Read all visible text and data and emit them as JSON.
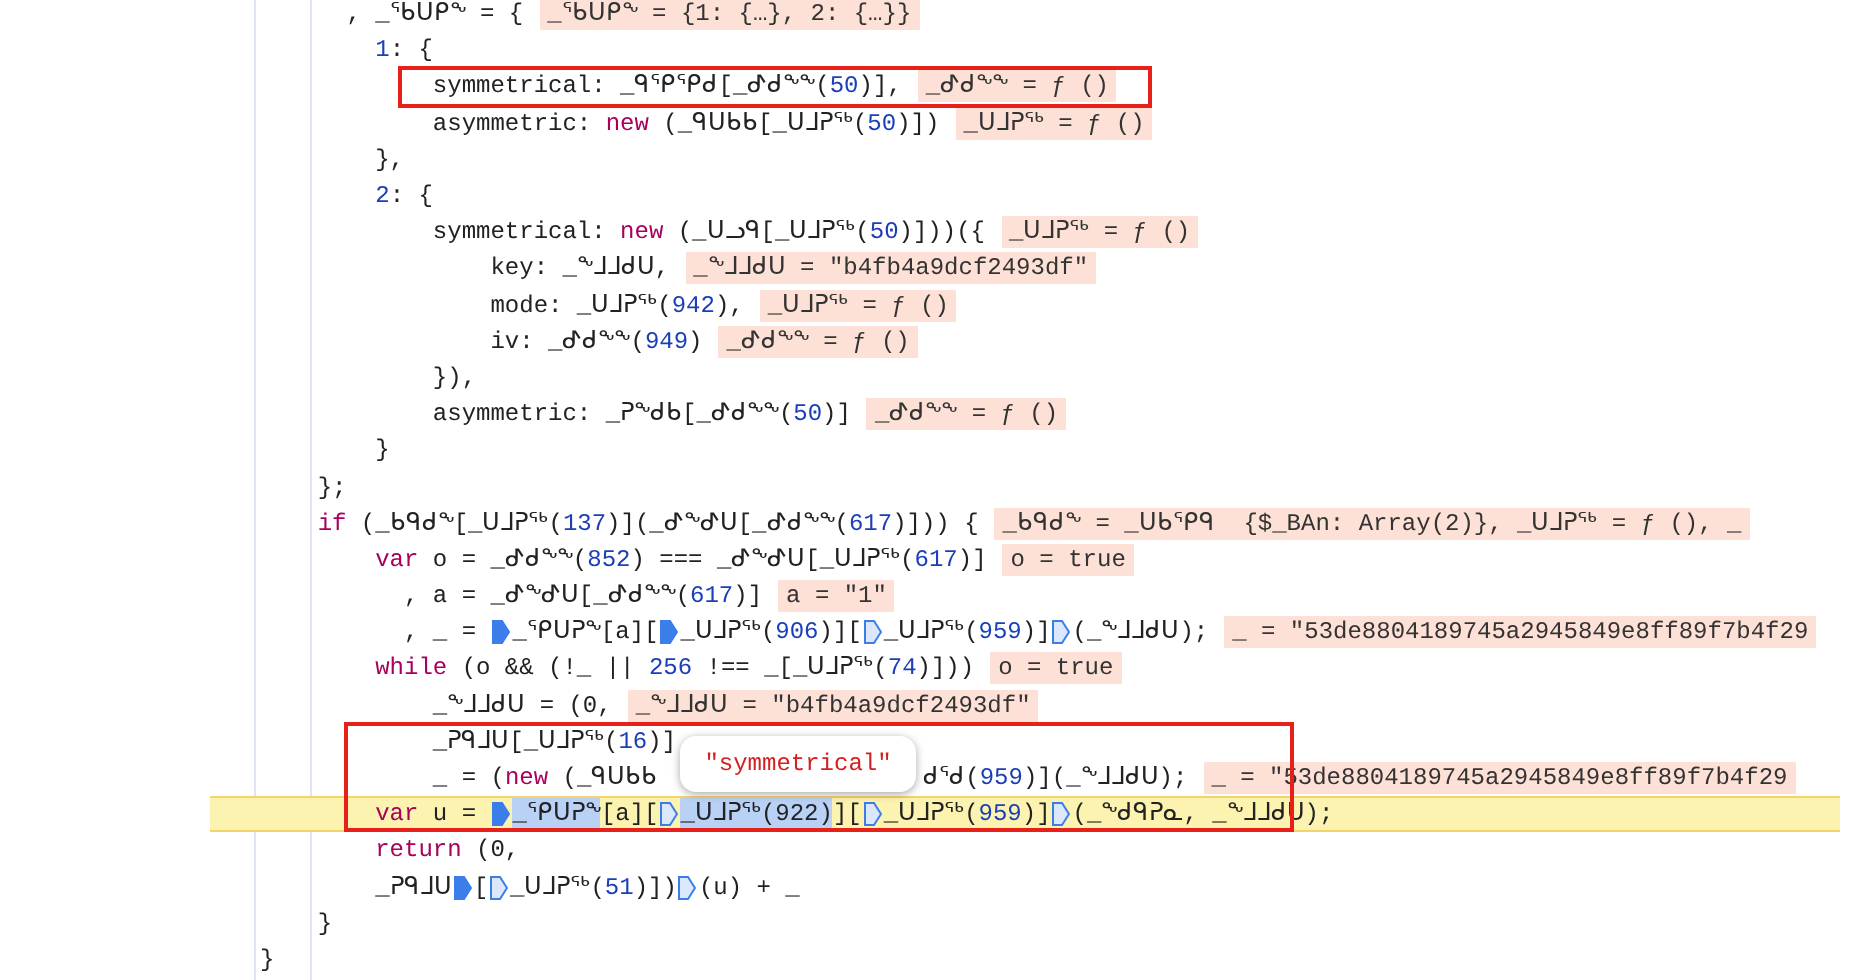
{
  "code_lines": [
    {
      "tokens": [
        {
          "t": "      , _ᖃᑌᑭᖕ = {",
          "kind": "code"
        }
      ],
      "value": "_ᖃᑌᑭᖕ = {1: {…}, 2: {…}}",
      "current": false
    },
    {
      "tokens": [
        {
          "t": "        1",
          "kind": "num"
        },
        {
          "t": ": {",
          "kind": "code"
        }
      ],
      "current": false
    },
    {
      "tokens": [
        {
          "t": "            symmetrical: _ᑫᕿᕿᑯ[_ᕷᑯᖕᖕ(",
          "kind": "code"
        },
        {
          "t": "50",
          "kind": "num"
        },
        {
          "t": ")],",
          "kind": "code"
        }
      ],
      "value": "_ᕷᑯᖕᖕ = ƒ ()",
      "current": false
    },
    {
      "tokens": [
        {
          "t": "            asymmetric: ",
          "kind": "code"
        },
        {
          "t": "new",
          "kind": "kw"
        },
        {
          "t": " (_ᑫᑌᑲᑲ[_ᑌᒧᕈᖅ(",
          "kind": "code"
        },
        {
          "t": "50",
          "kind": "num"
        },
        {
          "t": ")])",
          "kind": "code"
        }
      ],
      "value": "_ᑌᒧᕈᖅ = ƒ ()",
      "current": false
    },
    {
      "tokens": [
        {
          "t": "        },",
          "kind": "code"
        }
      ],
      "current": false
    },
    {
      "tokens": [
        {
          "t": "        2",
          "kind": "num"
        },
        {
          "t": ": {",
          "kind": "code"
        }
      ],
      "current": false
    },
    {
      "tokens": [
        {
          "t": "            symmetrical: ",
          "kind": "code"
        },
        {
          "t": "new",
          "kind": "kw"
        },
        {
          "t": " (_ᑌᓗᑫ[_ᑌᒧᕈᖅ(",
          "kind": "code"
        },
        {
          "t": "50",
          "kind": "num"
        },
        {
          "t": ")]))({",
          "kind": "code"
        }
      ],
      "value": "_ᑌᒧᕈᖅ = ƒ ()",
      "current": false
    },
    {
      "tokens": [
        {
          "t": "                key: _ᖕᒧᒧᑯᑌ,",
          "kind": "code"
        }
      ],
      "value": "_ᖕᒧᒧᑯᑌ = \"b4fb4a9dcf2493df\"",
      "current": false
    },
    {
      "tokens": [
        {
          "t": "                mode: _ᑌᒧᕈᖅ(",
          "kind": "code"
        },
        {
          "t": "942",
          "kind": "num"
        },
        {
          "t": "),",
          "kind": "code"
        }
      ],
      "value": "_ᑌᒧᕈᖅ = ƒ ()",
      "current": false
    },
    {
      "tokens": [
        {
          "t": "                iv: _ᕷᑯᖕᖕ(",
          "kind": "code"
        },
        {
          "t": "949",
          "kind": "num"
        },
        {
          "t": ")",
          "kind": "code"
        }
      ],
      "value": "_ᕷᑯᖕᖕ = ƒ ()",
      "current": false
    },
    {
      "tokens": [
        {
          "t": "            }),",
          "kind": "code"
        }
      ],
      "current": false
    },
    {
      "tokens": [
        {
          "t": "            asymmetric: _ᕈᖕᑯᑲ[_ᕷᑯᖕᖕ(",
          "kind": "code"
        },
        {
          "t": "50",
          "kind": "num"
        },
        {
          "t": ")]",
          "kind": "code"
        }
      ],
      "value": "_ᕷᑯᖕᖕ = ƒ ()",
      "current": false
    },
    {
      "tokens": [
        {
          "t": "        }",
          "kind": "code"
        }
      ],
      "current": false
    },
    {
      "tokens": [
        {
          "t": "    };",
          "kind": "code"
        }
      ],
      "current": false
    },
    {
      "tokens": [
        {
          "t": "    if",
          "kind": "kw"
        },
        {
          "t": " (_ᑲᑫᑯᖕ[_ᑌᒧᕈᖅ(",
          "kind": "code"
        },
        {
          "t": "137",
          "kind": "num"
        },
        {
          "t": ")](_ᕷᖕᕷᑌ[_ᕷᑯᖕᖕ(",
          "kind": "code"
        },
        {
          "t": "617",
          "kind": "num"
        },
        {
          "t": ")])) {",
          "kind": "code"
        }
      ],
      "value": "_ᑲᑫᑯᖕ = _ᑌᑲᕿᑫ  {$_BAn: Array(2)}, _ᑌᒧᕈᖅ = ƒ (), _",
      "current": false
    },
    {
      "tokens": [
        {
          "t": "        var",
          "kind": "kw"
        },
        {
          "t": " o = _ᕷᑯᖕᖕ(",
          "kind": "code"
        },
        {
          "t": "852",
          "kind": "num"
        },
        {
          "t": ") === _ᕷᖕᕷᑌ[_ᑌᒧᕈᖅ(",
          "kind": "code"
        },
        {
          "t": "617",
          "kind": "num"
        },
        {
          "t": ")]",
          "kind": "code"
        }
      ],
      "value": "o = true",
      "current": false
    },
    {
      "tokens": [
        {
          "t": "          , a = _ᕷᖕᕷᑌ[_ᕷᑯᖕᖕ(",
          "kind": "code"
        },
        {
          "t": "617",
          "kind": "num"
        },
        {
          "t": ")]",
          "kind": "code"
        }
      ],
      "value": "a = \"1\"",
      "current": false
    },
    {
      "tokens": [
        {
          "t": "          , _ = ",
          "kind": "code"
        },
        {
          "kind": "marker"
        },
        {
          "t": "_ᕿᑌᕈᖕ[a][",
          "kind": "code"
        },
        {
          "kind": "marker"
        },
        {
          "t": "_ᑌᒧᕈᖅ(",
          "kind": "code"
        },
        {
          "t": "906",
          "kind": "num"
        },
        {
          "t": ")][",
          "kind": "code"
        },
        {
          "kind": "marker_hollow"
        },
        {
          "t": "_ᑌᒧᕈᖅ(",
          "kind": "code"
        },
        {
          "t": "959",
          "kind": "num"
        },
        {
          "t": ")]",
          "kind": "code"
        },
        {
          "kind": "marker_hollow"
        },
        {
          "t": "(_ᖕᒧᒧᑯᑌ);",
          "kind": "code"
        }
      ],
      "value": "_ = \"53de8804189745a2945849e8ff89f7b4f29",
      "current": false
    },
    {
      "tokens": [
        {
          "t": "        while",
          "kind": "kw"
        },
        {
          "t": " (o && (!_ || ",
          "kind": "code"
        },
        {
          "t": "256",
          "kind": "num"
        },
        {
          "t": " !== _[_ᑌᒧᕈᖅ(",
          "kind": "code"
        },
        {
          "t": "74",
          "kind": "num"
        },
        {
          "t": ")]))",
          "kind": "code"
        }
      ],
      "value": "o = true",
      "current": false
    },
    {
      "tokens": [
        {
          "t": "            _ᖕᒧᒧᑯᑌ = (0,",
          "kind": "code"
        }
      ],
      "value": "_ᖕᒧᒧᑯᑌ = \"b4fb4a9dcf2493df\"",
      "current": false
    },
    {
      "tokens": [
        {
          "t": "            _ᕈᑫᒧᑌ[_ᑌᒧᕈᖅ(",
          "kind": "code"
        },
        {
          "t": "16",
          "kind": "num"
        },
        {
          "t": ")]",
          "kind": "code"
        }
      ],
      "current": false
    },
    {
      "tokens": [
        {
          "t": "            _ = (",
          "kind": "code"
        },
        {
          "t": "new",
          "kind": "kw"
        },
        {
          "t": " (_ᑫᑌᑲᑲ",
          "kind": "code"
        },
        {
          "t": "ᑯᕐᑯ(",
          "kind": "resume"
        },
        {
          "t": "959",
          "kind": "num"
        },
        {
          "t": ")](_ᖕᒧᒧᑯᑌ);",
          "kind": "code"
        }
      ],
      "value": "_ = \"53de8804189745a2945849e8ff89f7b4f29",
      "current": false
    },
    {
      "tokens": [
        {
          "t": "        var",
          "kind": "kw"
        },
        {
          "t": " u = ",
          "kind": "code"
        },
        {
          "kind": "marker"
        },
        {
          "t": "_ᕿᑌᕈᖕ",
          "kind": "sel"
        },
        {
          "t": "[a][",
          "kind": "code"
        },
        {
          "kind": "marker_hollow"
        },
        {
          "t": "_ᑌᒧᕈᖅ(922)",
          "kind": "sel"
        },
        {
          "t": "][",
          "kind": "code"
        },
        {
          "kind": "marker_hollow"
        },
        {
          "t": "_ᑌᒧᕈᖅ(",
          "kind": "code"
        },
        {
          "t": "959",
          "kind": "num"
        },
        {
          "t": ")]",
          "kind": "code"
        },
        {
          "kind": "marker_hollow"
        },
        {
          "t": "(_ᖕᑯᑫᕈᓇ, _ᖕᒧᒧᑯᑌ);",
          "kind": "code"
        }
      ],
      "current": true
    },
    {
      "tokens": [
        {
          "t": "        return",
          "kind": "kw"
        },
        {
          "t": " (0,",
          "kind": "code"
        }
      ],
      "current": false
    },
    {
      "tokens": [
        {
          "t": "        _ᕈᑫᒧᑌ",
          "kind": "code"
        },
        {
          "kind": "marker"
        },
        {
          "t": "[",
          "kind": "code"
        },
        {
          "kind": "marker_hollow"
        },
        {
          "t": "_ᑌᒧᕈᖅ(",
          "kind": "code"
        },
        {
          "t": "51",
          "kind": "num"
        },
        {
          "t": ")])",
          "kind": "code"
        },
        {
          "kind": "marker_hollow"
        },
        {
          "t": "(u) + _",
          "kind": "code"
        }
      ],
      "current": false
    },
    {
      "tokens": [
        {
          "t": "    }",
          "kind": "code"
        }
      ],
      "current": false
    },
    {
      "tokens": [
        {
          "t": "}",
          "kind": "code"
        }
      ],
      "current": false
    }
  ],
  "tooltip": {
    "text": "\"symmetrical\""
  }
}
